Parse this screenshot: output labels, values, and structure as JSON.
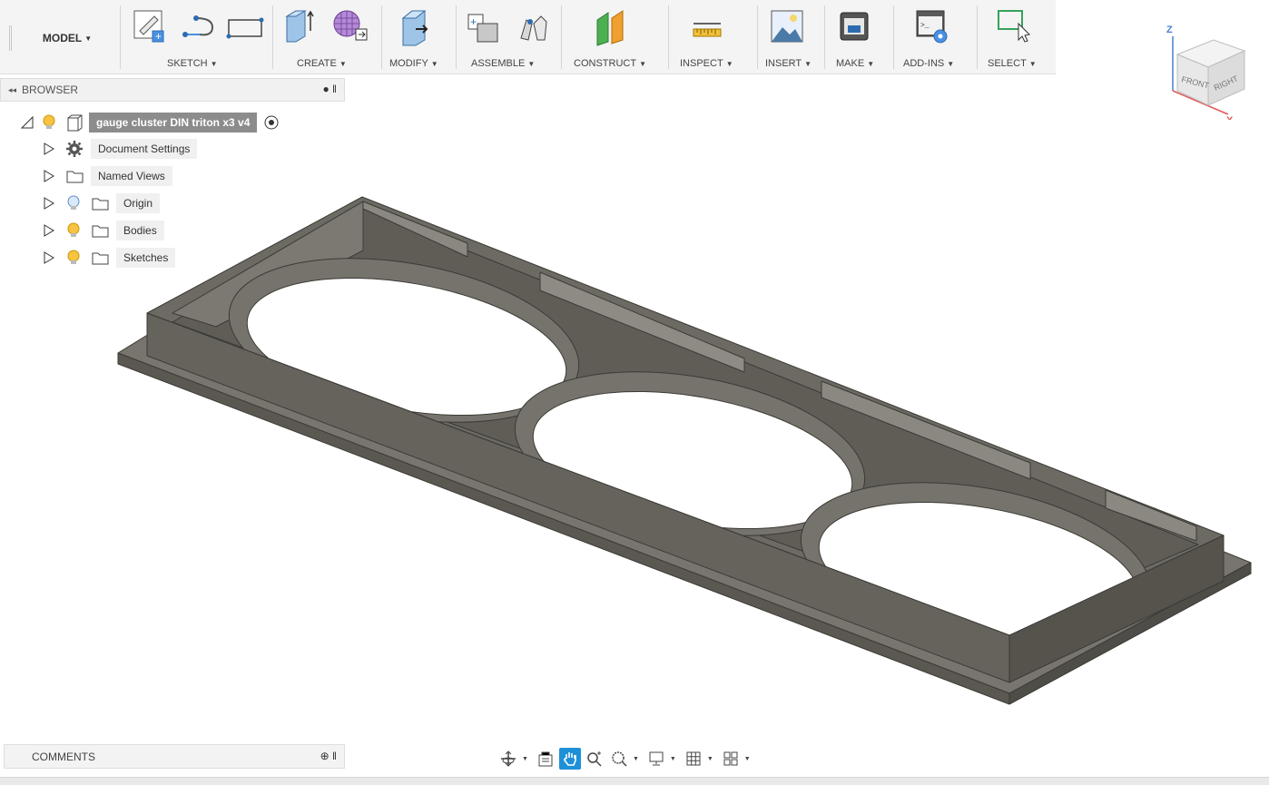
{
  "toolbar": {
    "workspace": "MODEL",
    "groups": [
      {
        "label": "SKETCH"
      },
      {
        "label": "CREATE"
      },
      {
        "label": "MODIFY"
      },
      {
        "label": "ASSEMBLE"
      },
      {
        "label": "CONSTRUCT"
      },
      {
        "label": "INSPECT"
      },
      {
        "label": "INSERT"
      },
      {
        "label": "MAKE"
      },
      {
        "label": "ADD-INS"
      },
      {
        "label": "SELECT"
      }
    ]
  },
  "browser": {
    "title": "BROWSER",
    "root": {
      "label": "gauge cluster DIN triton x3 v4"
    },
    "items": [
      {
        "label": "Document Settings",
        "icon": "gear-icon"
      },
      {
        "label": "Named Views",
        "icon": "folder-icon"
      },
      {
        "label": "Origin",
        "icon": "folder-icon",
        "visibility": "lightbulb-off-icon"
      },
      {
        "label": "Bodies",
        "icon": "folder-icon",
        "visibility": "lightbulb-on-icon"
      },
      {
        "label": "Sketches",
        "icon": "folder-icon",
        "visibility": "lightbulb-on-icon"
      }
    ]
  },
  "comments": {
    "title": "COMMENTS"
  },
  "viewcube": {
    "front": "FRONT",
    "right": "RIGHT",
    "axis_z": "Z",
    "axis_x": "X"
  },
  "colors": {
    "accent": "#1e90d8",
    "model_top": "#6d6b63",
    "model_light": "#8b8980",
    "model_dark": "#55534c",
    "model_edge": "#3a3934"
  }
}
